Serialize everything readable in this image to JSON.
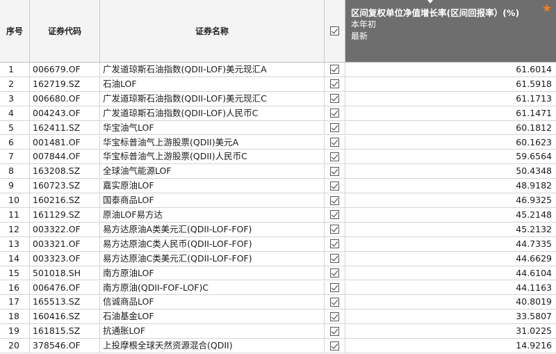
{
  "header": {
    "idx": "序号",
    "code": "证券代码",
    "name": "证券名称",
    "metric_title": "区间复权单位净值增长率(区间回报率）(%)",
    "metric_start": "本年初",
    "metric_end": "最新"
  },
  "rows": [
    {
      "idx": "1",
      "code": "006679.OF",
      "name": "广发道琼斯石油指数(QDII-LOF)美元现汇A",
      "value": "61.6014"
    },
    {
      "idx": "2",
      "code": "162719.SZ",
      "name": "石油LOF",
      "value": "61.5918"
    },
    {
      "idx": "3",
      "code": "006680.OF",
      "name": "广发道琼斯石油指数(QDII-LOF)美元现汇C",
      "value": "61.1713"
    },
    {
      "idx": "4",
      "code": "004243.OF",
      "name": "广发道琼斯石油指数(QDII-LOF)人民币C",
      "value": "61.1471"
    },
    {
      "idx": "5",
      "code": "162411.SZ",
      "name": "华宝油气LOF",
      "value": "60.1812"
    },
    {
      "idx": "6",
      "code": "001481.OF",
      "name": "华宝标普油气上游股票(QDII)美元A",
      "value": "60.1623"
    },
    {
      "idx": "7",
      "code": "007844.OF",
      "name": "华宝标普油气上游股票(QDII)人民币C",
      "value": "59.6564"
    },
    {
      "idx": "8",
      "code": "163208.SZ",
      "name": "全球油气能源LOF",
      "value": "50.4348"
    },
    {
      "idx": "9",
      "code": "160723.SZ",
      "name": "嘉实原油LOF",
      "value": "48.9182"
    },
    {
      "idx": "10",
      "code": "160216.SZ",
      "name": "国泰商品LOF",
      "value": "46.9325"
    },
    {
      "idx": "11",
      "code": "161129.SZ",
      "name": "原油LOF易方达",
      "value": "45.2148"
    },
    {
      "idx": "12",
      "code": "003322.OF",
      "name": "易方达原油A类美元汇(QDII-LOF-FOF)",
      "value": "45.2132"
    },
    {
      "idx": "13",
      "code": "003321.OF",
      "name": "易方达原油C类人民币(QDII-LOF-FOF)",
      "value": "44.7335"
    },
    {
      "idx": "14",
      "code": "003323.OF",
      "name": "易方达原油C类美元汇(QDII-LOF-FOF)",
      "value": "44.6629"
    },
    {
      "idx": "15",
      "code": "501018.SH",
      "name": "南方原油LOF",
      "value": "44.6104"
    },
    {
      "idx": "16",
      "code": "006476.OF",
      "name": "南方原油(QDII-FOF-LOF)C",
      "value": "44.1163"
    },
    {
      "idx": "17",
      "code": "165513.SZ",
      "name": "信诚商品LOF",
      "value": "40.8019"
    },
    {
      "idx": "18",
      "code": "160416.SZ",
      "name": "石油基金LOF",
      "value": "33.5807"
    },
    {
      "idx": "19",
      "code": "161815.SZ",
      "name": "抗通胀LOF",
      "value": "31.0225"
    },
    {
      "idx": "20",
      "code": "378546.OF",
      "name": "上投摩根全球天然资源混合(QDII)",
      "value": "14.9216"
    }
  ],
  "icons": {
    "header_checkbox": "checkbox-checked-icon",
    "row_checkbox": "checkbox-checked-icon",
    "favorite": "star-icon",
    "sort": "sort-desc-icon"
  },
  "colors": {
    "metric_header_bg": "#6e6e6e",
    "star": "#ff7a1f"
  }
}
